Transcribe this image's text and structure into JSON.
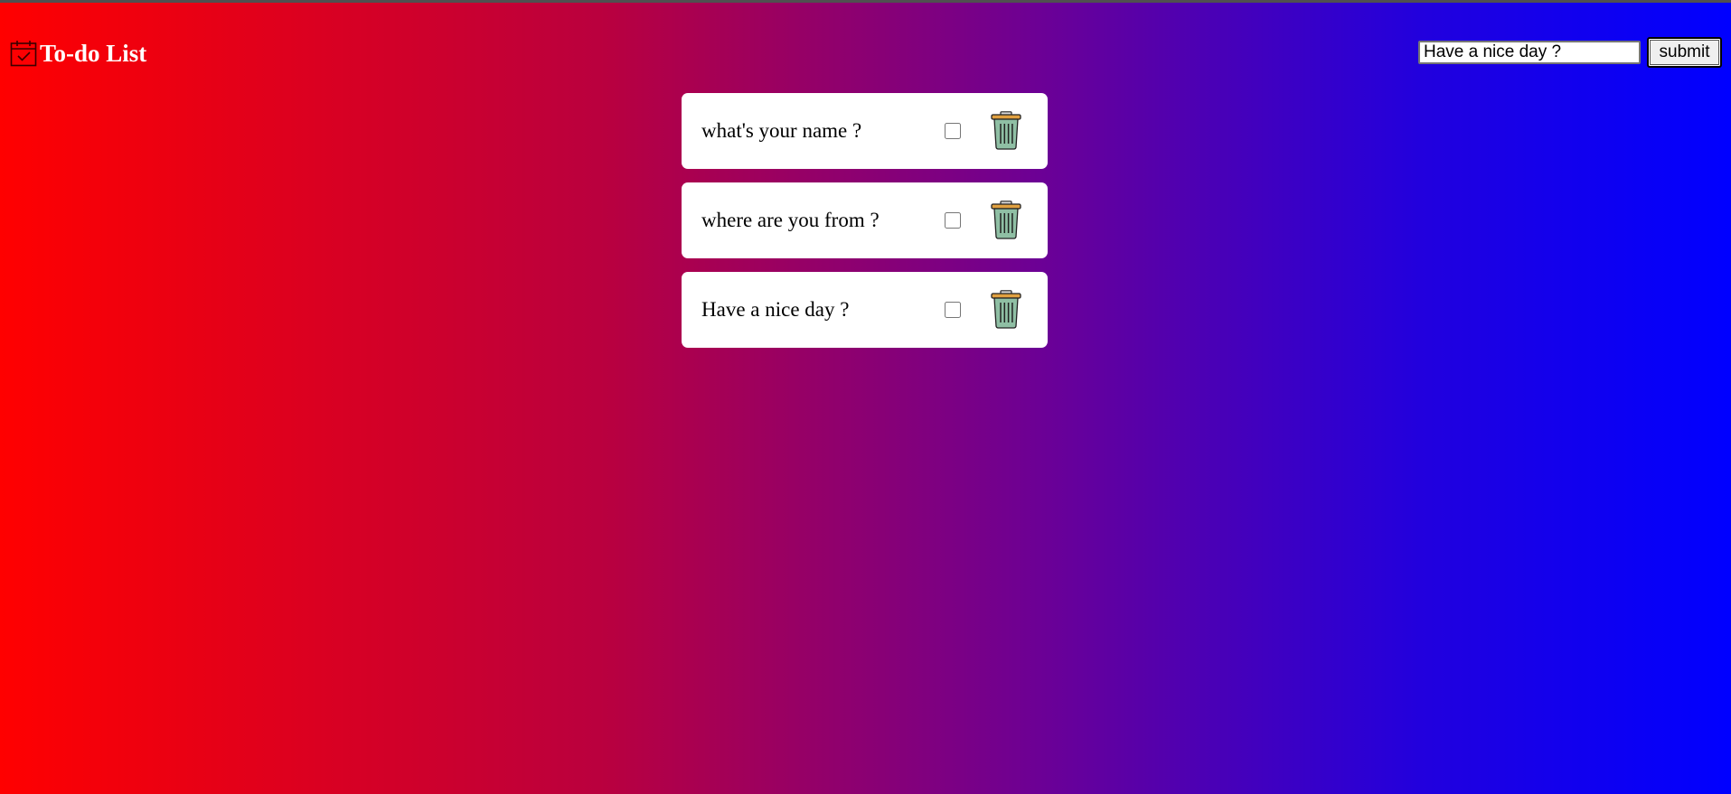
{
  "app": {
    "title": "To-do List",
    "logo_icon": "calendar-check-icon"
  },
  "form": {
    "input_value": "Have a nice day ?",
    "submit_label": "submit"
  },
  "todos": [
    {
      "text": "what's your name ?",
      "done": false,
      "delete_icon": "trash-can-icon"
    },
    {
      "text": "where are you from ?",
      "done": false,
      "delete_icon": "trash-can-icon"
    },
    {
      "text": "Have a nice day ?",
      "done": false,
      "delete_icon": "trash-can-icon"
    }
  ],
  "colors": {
    "gradient_start": "#ff0000",
    "gradient_end": "#0000ff",
    "card_bg": "#ffffff",
    "trash_body": "#8fbfa4",
    "trash_lid": "#e0a040"
  }
}
